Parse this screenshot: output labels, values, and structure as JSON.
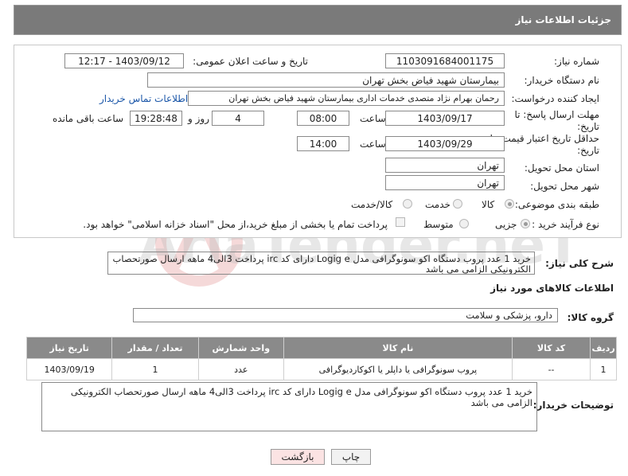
{
  "header": {
    "title": "جزئیات اطلاعات نیاز"
  },
  "form": {
    "need_number_label": "شماره نیاز:",
    "need_number": "1103091684001175",
    "announce_label": "تاریخ و ساعت اعلان عمومی:",
    "announce_value": "1403/09/12 - 12:17",
    "buyer_org_label": "نام دستگاه خریدار:",
    "buyer_org": "بیمارستان شهید فیاض بخش تهران",
    "creator_label": "ایجاد کننده درخواست:",
    "creator": "رحمان بهرام نژاد متصدی خدمات اداری بیمارستان شهید فیاض بخش تهران",
    "contact_link": "اطلاعات تماس خریدار",
    "reply_deadline_label_1": "مهلت ارسال پاسخ: تا",
    "reply_deadline_label_2": "تاریخ:",
    "reply_date": "1403/09/17",
    "time_label": "ساعت",
    "reply_time": "08:00",
    "days_value": "4",
    "days_label": "روز و",
    "remaining_time": "19:28:48",
    "remaining_label": "ساعت باقی مانده",
    "validity_label_1": "حداقل تاریخ اعتبار قیمت: تا",
    "validity_label_2": "تاریخ:",
    "validity_date": "1403/09/29",
    "validity_time": "14:00",
    "province_label": "استان محل تحویل:",
    "province": "تهران",
    "city_label": "شهر محل تحویل:",
    "city": "تهران",
    "category_label": "طبقه بندی موضوعی:",
    "category_options": [
      "کالا",
      "خدمت",
      "کالا/خدمت"
    ],
    "category_selected": "کالا",
    "process_label": "نوع فرآیند خرید :",
    "process_options": [
      "جزیی",
      "متوسط"
    ],
    "process_selected": "جزیی",
    "payment_note": "پرداخت تمام یا بخشی از مبلغ خرید،از محل \"اسناد خزانه اسلامی\" خواهد بود."
  },
  "description": {
    "label": "شرح کلی نیاز:",
    "text": "خرید 1 عدد پروب دستگاه اکو سونوگرافی مدل Logig e دارای کد irc پرداخت 3الی4 ماهه ارسال صورتحصاب الکترونیکی الزامی می باشد"
  },
  "goods_info": {
    "title": "اطلاعات کالاهای مورد نیاز",
    "group_label": "گروه کالا:",
    "group_value": "دارو، پزشکی و سلامت"
  },
  "table": {
    "columns": [
      "ردیف",
      "کد کالا",
      "نام کالا",
      "واحد شمارش",
      "تعداد / مقدار",
      "تاریخ نیاز"
    ],
    "rows": [
      [
        "1",
        "--",
        "پروب سونوگرافی یا داپلر یا اکوکاردیوگرافی",
        "عدد",
        "1",
        "1403/09/19"
      ]
    ]
  },
  "buyer_notes": {
    "label": "توضیحات خریدار:",
    "text": "خرید 1 عدد پروب دستگاه اکو سونوگرافی مدل Logig e دارای کد irc پرداخت 3الی4 ماهه ارسال صورتحصاب الکترونیکی الزامی می باشد"
  },
  "buttons": {
    "print": "چاپ",
    "back": "بازگشت"
  },
  "watermark": {
    "text": "AriaTender.neT"
  },
  "colors": {
    "header_bg": "#7a7a7a",
    "table_header_bg": "#8a8a8a",
    "link": "#1a56a8",
    "back_button_bg": "#fbe3e3"
  }
}
